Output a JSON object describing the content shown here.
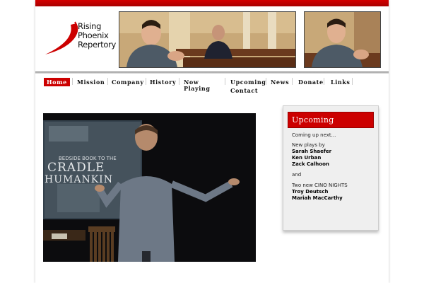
{
  "logo": {
    "lines": [
      "Rising",
      "Phoenix",
      "Repertory"
    ]
  },
  "nav": {
    "home": "Home",
    "mission": "Mission",
    "company": "Company",
    "history": "History",
    "now_playing_1": "Now",
    "now_playing_2": "Playing",
    "upcoming": "Upcoming",
    "news": "News",
    "donate": "Donate",
    "links": "Links",
    "contact": "Contact"
  },
  "video": {
    "poster_lines": [
      "CRADLE",
      "HUMANKIN"
    ],
    "poster_small": "BEDSIDE BOOK TO THE"
  },
  "sidebar": {
    "title": "Upcoming",
    "intro": "Coming up next...",
    "plays_label": "New plays by",
    "playwrights": [
      "Sarah Shaefer",
      "Ken Urban",
      "Zack Calhoon"
    ],
    "and": "and",
    "cino_label": "Two new CINO NIGHTS",
    "cino_names": [
      "Troy Deutsch",
      "Mariah MacCarthy"
    ]
  },
  "colors": {
    "accent": "#cc0000",
    "dark_accent": "#990000"
  }
}
